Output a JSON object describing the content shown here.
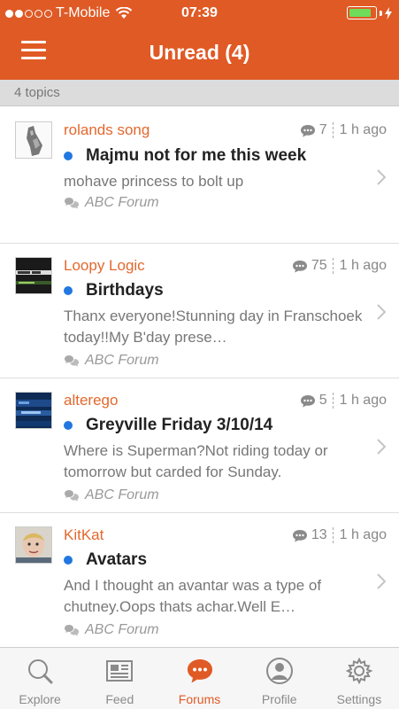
{
  "status_bar": {
    "carrier": "T-Mobile",
    "time": "07:39",
    "battery_level": 0.85,
    "signal_bars_filled": 2,
    "signal_bars_total": 5
  },
  "header": {
    "title": "Unread (4)",
    "menu_icon": "hamburger-menu-icon"
  },
  "section": {
    "label": "4 topics"
  },
  "colors": {
    "brand": "#e05a25",
    "author": "#e3682e",
    "unread_dot": "#2277e0"
  },
  "topics": [
    {
      "author": "rolands song",
      "reply_count": "7",
      "time_ago": "1 h ago",
      "subject": "Majmu not for me this week",
      "preview": "mohave princess to bolt up",
      "forum": "ABC Forum"
    },
    {
      "author": "Loopy Logic",
      "reply_count": "75",
      "time_ago": "1 h ago",
      "subject": "Birthdays",
      "preview": "Thanx everyone!Stunning day in Franschoek today!!My B'day prese…",
      "forum": "ABC Forum"
    },
    {
      "author": "alterego",
      "reply_count": "5",
      "time_ago": "1 h ago",
      "subject": "Greyville Friday 3/10/14",
      "preview": "Where is Superman?Not riding today or tomorrow but carded for Sunday.",
      "forum": "ABC Forum"
    },
    {
      "author": "KitKat",
      "reply_count": "13",
      "time_ago": "1 h ago",
      "subject": "Avatars",
      "preview": "And I thought an avantar was a type of chutney.Oops thats achar.Well E…",
      "forum": "ABC Forum"
    }
  ],
  "tabbar": {
    "tabs": [
      {
        "label": "Explore",
        "icon": "search-icon",
        "active": false
      },
      {
        "label": "Feed",
        "icon": "newspaper-icon",
        "active": false
      },
      {
        "label": "Forums",
        "icon": "chat-bubble-icon",
        "active": true
      },
      {
        "label": "Profile",
        "icon": "person-icon",
        "active": false
      },
      {
        "label": "Settings",
        "icon": "gear-icon",
        "active": false
      }
    ]
  }
}
